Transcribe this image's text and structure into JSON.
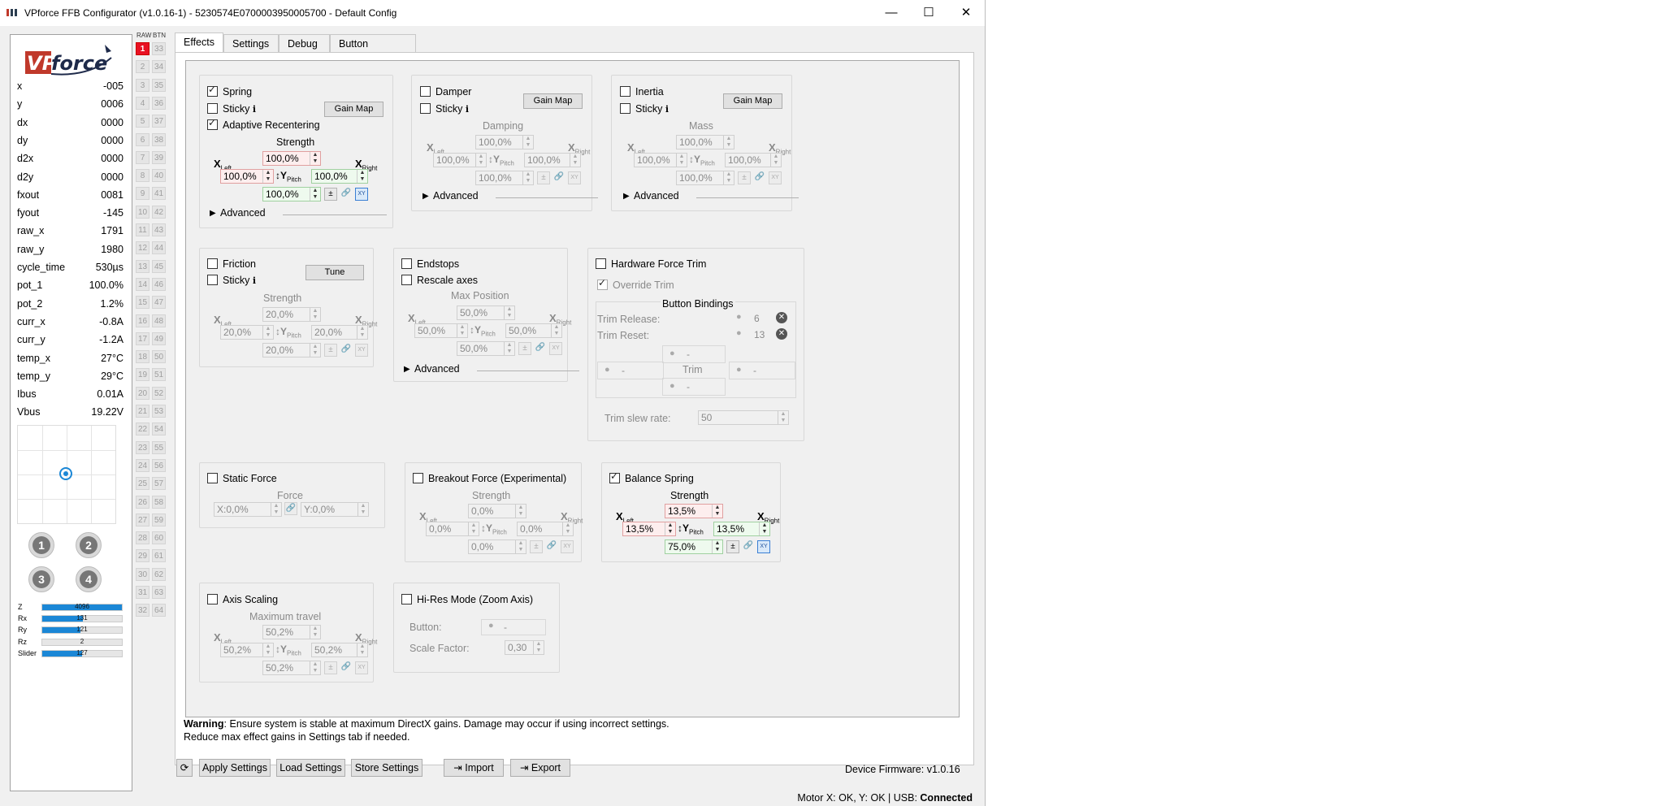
{
  "window": {
    "title": "VPforce FFB Configurator (v1.0.16-1) - 5230574E0700003950005700 - Default Config",
    "minimize": "—",
    "maximize": "☐",
    "close": "✕"
  },
  "sidebar": {
    "logo_text": "VPforce",
    "readouts": [
      {
        "k": "x",
        "v": "-005"
      },
      {
        "k": "y",
        "v": "0006"
      },
      {
        "k": "dx",
        "v": "0000"
      },
      {
        "k": "dy",
        "v": "0000"
      },
      {
        "k": "d2x",
        "v": "0000"
      },
      {
        "k": "d2y",
        "v": "0000"
      },
      {
        "k": "fxout",
        "v": "0081"
      },
      {
        "k": "fyout",
        "v": "-145"
      },
      {
        "k": "raw_x",
        "v": "1791"
      },
      {
        "k": "raw_y",
        "v": "1980"
      },
      {
        "k": "cycle_time",
        "v": "530µs"
      },
      {
        "k": "pot_1",
        "v": "100.0%"
      },
      {
        "k": "pot_2",
        "v": "1.2%"
      },
      {
        "k": "curr_x",
        "v": "-0.8A"
      },
      {
        "k": "curr_y",
        "v": "-1.2A"
      },
      {
        "k": "temp_x",
        "v": "27°C"
      },
      {
        "k": "temp_y",
        "v": "29°C"
      },
      {
        "k": "Ibus",
        "v": "0.01A"
      },
      {
        "k": "Vbus",
        "v": "19.22V"
      }
    ],
    "hat_buttons": [
      "1",
      "2",
      "3",
      "4"
    ],
    "axes": [
      {
        "name": "Z",
        "value": "4096",
        "fill": 1.0
      },
      {
        "name": "Rx",
        "value": "131",
        "fill": 0.51
      },
      {
        "name": "Ry",
        "value": "121",
        "fill": 0.48
      },
      {
        "name": "Rz",
        "value": "2",
        "fill": 0.0
      },
      {
        "name": "Slider",
        "value": "127",
        "fill": 0.5
      }
    ]
  },
  "buttons_panel": {
    "header_raw": "RAW",
    "header_btn": "BTN",
    "active": "1"
  },
  "tabs": [
    {
      "label": "Effects",
      "active": true
    },
    {
      "label": "Settings"
    },
    {
      "label": "Debug"
    },
    {
      "label": "Button Mapping"
    }
  ],
  "effects": {
    "spring": {
      "label": "Spring",
      "checked": true,
      "sticky": "Sticky",
      "gain_map": "Gain Map",
      "adaptive": "Adaptive Recentering",
      "strength_label": "Strength",
      "top": "100,0%",
      "left": "100,0%",
      "right": "100,0%",
      "bottom": "100,0%",
      "advanced": "Advanced"
    },
    "damper": {
      "label": "Damper",
      "sticky": "Sticky",
      "gain_map": "Gain Map",
      "sub_label": "Damping",
      "top": "100,0%",
      "left": "100,0%",
      "right": "100,0%",
      "bottom": "100,0%",
      "advanced": "Advanced"
    },
    "inertia": {
      "label": "Inertia",
      "sticky": "Sticky",
      "gain_map": "Gain Map",
      "sub_label": "Mass",
      "top": "100,0%",
      "left": "100,0%",
      "right": "100,0%",
      "bottom": "100,0%",
      "advanced": "Advanced"
    },
    "friction": {
      "label": "Friction",
      "sticky": "Sticky",
      "tune": "Tune",
      "sub_label": "Strength",
      "top": "20,0%",
      "left": "20,0%",
      "right": "20,0%",
      "bottom": "20,0%"
    },
    "endstops": {
      "label": "Endstops",
      "rescale": "Rescale axes",
      "sub_label": "Max Position",
      "top": "50,0%",
      "left": "50,0%",
      "right": "50,0%",
      "bottom": "50,0%",
      "advanced": "Advanced"
    },
    "hardware_trim": {
      "label": "Hardware Force Trim",
      "override": "Override Trim",
      "bindings_title": "Button Bindings",
      "release_label": "Trim Release:",
      "release_value": "6",
      "reset_label": "Trim Reset:",
      "reset_value": "13",
      "dash": "-",
      "trim": "Trim",
      "slew_label": "Trim slew rate:",
      "slew_value": "50"
    },
    "static_force": {
      "label": "Static Force",
      "sub_label": "Force",
      "x": "X:0,0%",
      "y": "Y:0,0%"
    },
    "breakout": {
      "label": "Breakout Force (Experimental)",
      "sub_label": "Strength",
      "top": "0,0%",
      "left": "0,0%",
      "right": "0,0%",
      "bottom": "0,0%"
    },
    "balance_spring": {
      "label": "Balance Spring",
      "checked": true,
      "sub_label": "Strength",
      "top": "13,5%",
      "left": "13,5%",
      "right": "13,5%",
      "bottom": "75,0%"
    },
    "axis_scaling": {
      "label": "Axis Scaling",
      "sub_label": "Maximum travel",
      "top": "50,2%",
      "left": "50,2%",
      "right": "50,2%",
      "bottom": "50,2%"
    },
    "hires": {
      "label": "Hi-Res Mode (Zoom Axis)",
      "button_label": "Button:",
      "button_value": "-",
      "scale_label": "Scale Factor:",
      "scale_value": "0,30"
    },
    "axis_x_left": "X",
    "axis_x_left_sub": "Left",
    "axis_x_right": "X",
    "axis_x_right_sub": "Right",
    "axis_y": "Y",
    "axis_y_sub": "Pitch",
    "pm": "±",
    "xy": "XY"
  },
  "warning": {
    "bold": "Warning",
    "line1": ": Ensure system is stable at maximum DirectX gains. Damage may occur if using incorrect settings.",
    "line2": "Reduce max effect gains in Settings tab if needed."
  },
  "bottom_bar": {
    "refresh": "⟳",
    "apply": "Apply Settings",
    "load": "Load Settings",
    "store": "Store Settings",
    "import": "Import",
    "export": "Export",
    "firmware": "Device Firmware: v1.0.16"
  },
  "status": {
    "text": "Motor X: OK, Y: OK | USB: ",
    "connected": "Connected"
  }
}
